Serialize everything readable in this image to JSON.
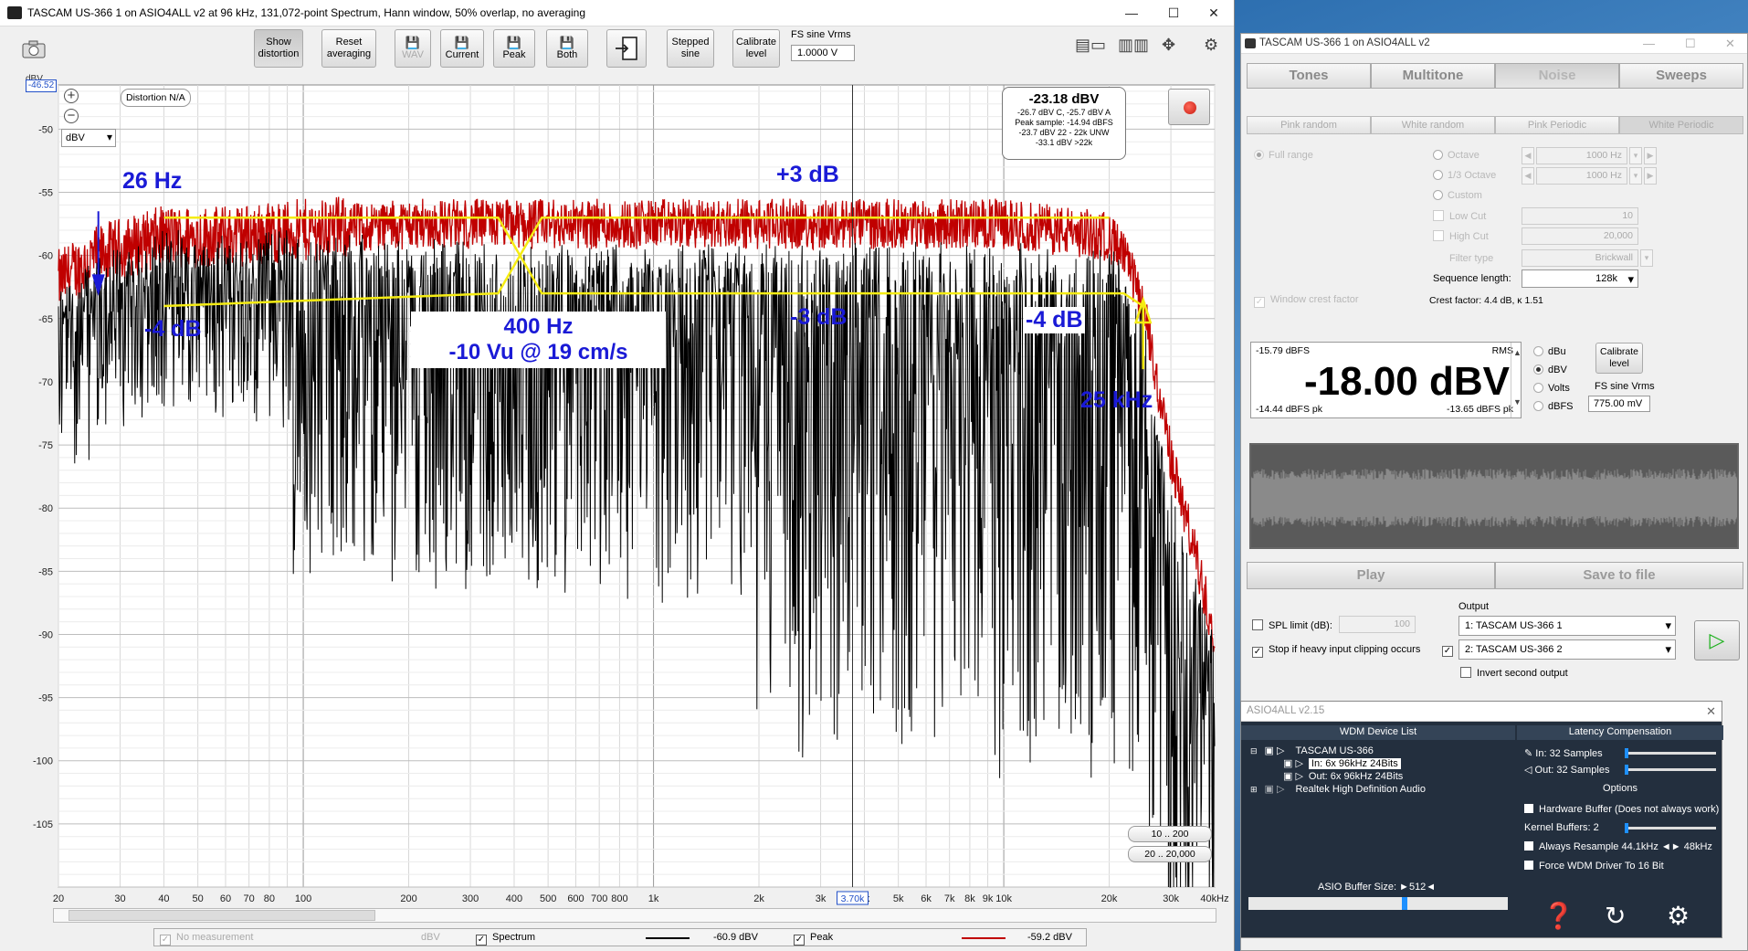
{
  "main_window": {
    "title": "TASCAM US-366 1 on ASIO4ALL v2 at 96 kHz, 131,072-point Spectrum, Hann window, 50% overlap, no averaging",
    "toolbar": {
      "show_distortion": [
        "Show",
        "distortion"
      ],
      "reset_averaging": [
        "Reset",
        "averaging"
      ],
      "wav": "WAV",
      "current": "Current",
      "peak": "Peak",
      "both": "Both",
      "stepped_sine": [
        "Stepped",
        "sine"
      ],
      "calibrate_level": [
        "Calibrate",
        "level"
      ],
      "fs_sine_label": "FS sine Vrms",
      "fs_sine_value": "1.0000 V"
    }
  },
  "graph": {
    "y_unit_top": "dBV",
    "cursor_value": "-46.52",
    "distortion_na": "Distortion N/A",
    "unit_select": "dBV",
    "level_box": {
      "main": "-23.18 dBV",
      "lines": [
        "-26.7 dBV C, -25.7 dBV A",
        "Peak sample: -14.94 dBFS",
        "-23.7 dBV 22 - 22k UNW",
        "-33.1 dBV >22k"
      ]
    },
    "range_buttons": [
      "10 .. 200",
      "20 .. 20,000"
    ],
    "cursor_freq": "3.70k",
    "annotations": {
      "f26": "26 Hz",
      "plus3": "+3 dB",
      "minus4_left": "-4 dB",
      "box400_line1": "400 Hz",
      "box400_line2": "-10 Vu @ 19 cm/s",
      "minus3": "-3 dB",
      "minus4_right": "-4 dB",
      "f25k": "25 kHz"
    }
  },
  "chart_data": {
    "type": "line",
    "title": "",
    "xlabel": "",
    "ylabel": "dBV",
    "x_scale": "log",
    "xlim": [
      20,
      40000
    ],
    "ylim": [
      -110,
      -46.5
    ],
    "grid": true,
    "x_ticks": [
      "20",
      "30",
      "40",
      "50",
      "60",
      "70",
      "80",
      "100",
      "200",
      "300",
      "400",
      "500",
      "600",
      "700",
      "800",
      "1k",
      "2k",
      "3k",
      "4k",
      "5k",
      "6k",
      "7k",
      "8k",
      "9k",
      "10k",
      "20k",
      "30k",
      "40kHz"
    ],
    "y_ticks": [
      "-50",
      "-55",
      "-60",
      "-65",
      "-70",
      "-75",
      "-80",
      "-85",
      "-90",
      "-95",
      "-100",
      "-105"
    ],
    "series": [
      {
        "name": "Spectrum",
        "color": "#000000",
        "legend_value": "-60.9 dBV",
        "x": [
          20,
          26,
          40,
          60,
          100,
          200,
          400,
          1000,
          3000,
          10000,
          20000,
          22000,
          25000,
          30000,
          40000
        ],
        "y": [
          -64,
          -62,
          -60,
          -60,
          -60,
          -60.5,
          -61,
          -61,
          -61,
          -61,
          -61.5,
          -62,
          -66,
          -80,
          -92
        ]
      },
      {
        "name": "Peak",
        "color": "#c00000",
        "legend_value": "-59.2 dBV",
        "x": [
          20,
          26,
          40,
          60,
          100,
          200,
          400,
          1000,
          3000,
          10000,
          20000,
          22000,
          25000,
          30000,
          40000
        ],
        "y": [
          -62,
          -60,
          -58.5,
          -58.5,
          -58,
          -57.5,
          -57.5,
          -57.5,
          -57.5,
          -57.5,
          -58.5,
          -60,
          -64,
          -76,
          -90
        ]
      }
    ]
  },
  "legend": {
    "no_measurement": "No measurement",
    "no_measurement_unit": "dBV",
    "spectrum": "Spectrum",
    "spectrum_value": "-60.9 dBV",
    "peak": "Peak",
    "peak_value": "-59.2 dBV"
  },
  "generator": {
    "title": "TASCAM US-366 1 on ASIO4ALL v2",
    "tabs": [
      "Tones",
      "Multitone",
      "Noise",
      "Sweeps"
    ],
    "subtabs": [
      "Pink random",
      "White random",
      "Pink Periodic",
      "White Periodic"
    ],
    "options": {
      "full_range": "Full range",
      "octave": "Octave",
      "third_octave": "1/3 Octave",
      "custom": "Custom",
      "low_cut": "Low Cut",
      "high_cut": "High Cut",
      "filter_type": "Filter type",
      "filter_type_value": "Brickwall",
      "octave_freq": "1000 Hz",
      "third_freq": "1000 Hz",
      "low_cut_value": "10",
      "high_cut_value": "20,000",
      "sequence_length_label": "Sequence length:",
      "sequence_length_value": "128k",
      "window_crest": "Window crest factor",
      "crest_factor": "Crest factor: 4.4 dB, κ 1.51"
    },
    "rms": {
      "top_left": "-15.79 dBFS",
      "top_right": "RMS",
      "big": "-18.00 dBV",
      "bot_left": "-14.44 dBFS pk",
      "bot_right": "-13.65 dBFS pk",
      "units": [
        "dBu",
        "dBV",
        "Volts",
        "dBFS"
      ],
      "calibrate": [
        "Calibrate",
        "level"
      ],
      "fs_sine_label": "FS sine Vrms",
      "fs_sine_value": "775.00 mV"
    },
    "play": "Play",
    "save": "Save to file",
    "spl_limit": "SPL limit (dB):",
    "spl_value": "100",
    "stop_clip": "Stop if heavy input clipping occurs",
    "output_label": "Output",
    "output1": "1: TASCAM US-366 1",
    "output2": "2: TASCAM US-366 2",
    "invert": "Invert second output"
  },
  "asio": {
    "title": "ASIO4ALL v2.15",
    "wdm_header": "WDM Device List",
    "latency_header": "Latency Compensation",
    "device1": "TASCAM US-366",
    "in_line": "In: 6x 96kHz 24Bits",
    "out_line": "Out: 6x 96kHz 24Bits",
    "device2": "Realtek High Definition Audio",
    "lat_in": "In: 32 Samples",
    "lat_out": "Out: 32 Samples",
    "options_header": "Options",
    "hw_buffer": "Hardware Buffer (Does not always work)",
    "kernel_buffers": "Kernel Buffers: 2",
    "resample": "Always Resample 44.1kHz ◄► 48kHz",
    "force_wdm": "Force WDM Driver To 16 Bit",
    "buffer_size": "ASIO Buffer Size: ►512◄"
  }
}
